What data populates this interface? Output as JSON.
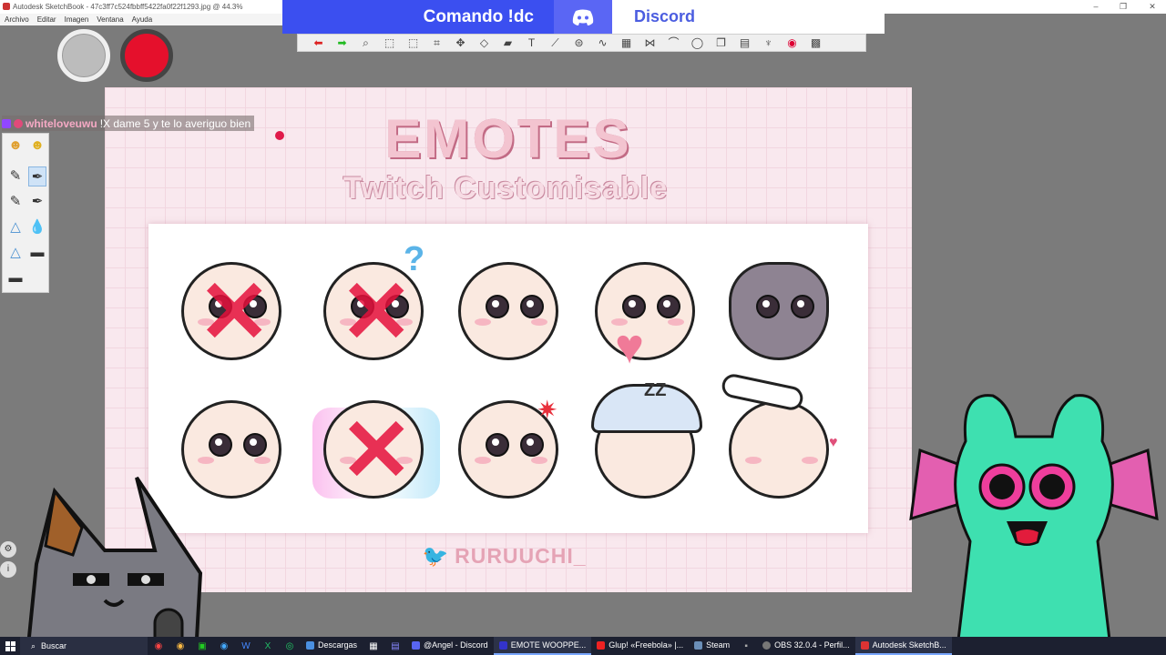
{
  "window": {
    "title": "Autodesk SketchBook - 47c3ff7c524fbbff5422fa0f22f1293.jpg @ 44.3%",
    "controls": [
      "–",
      "❐",
      "✕"
    ]
  },
  "menu": [
    "Archivo",
    "Editar",
    "Imagen",
    "Ventana",
    "Ayuda"
  ],
  "discord_overlay": {
    "command": "Comando !dc",
    "label": "Discord"
  },
  "toolbar": {
    "tools": [
      "undo-icon",
      "redo-icon",
      "zoom-icon",
      "select-icon",
      "lasso-icon",
      "crop-icon",
      "move-icon",
      "distort-icon",
      "fill-icon",
      "text-icon",
      "ruler-icon",
      "ellipse-icon",
      "curve-icon",
      "grid-icon",
      "symmetry-icon",
      "stroke-icon",
      "shape-icon",
      "layers-icon",
      "copic-icon",
      "brushes-icon",
      "color-wheel-icon",
      "palette-icon"
    ]
  },
  "colors": {
    "primary_puck": "#bcbcbc",
    "secondary_puck": "#e5102c",
    "canvas_bg": "#f9e8ee",
    "accent_pink": "#c26b85"
  },
  "canvas": {
    "title": "EMOTES",
    "subtitle": "Twitch Customisable",
    "credit": "RURUUCHI_",
    "emotes": [
      {
        "name": "emote-wave",
        "crossed": true
      },
      {
        "name": "emote-confused",
        "crossed": true
      },
      {
        "name": "emote-sad",
        "crossed": false
      },
      {
        "name": "emote-love",
        "crossed": false
      },
      {
        "name": "emote-shock",
        "crossed": false
      },
      {
        "name": "emote-sparkle",
        "crossed": false
      },
      {
        "name": "emote-hype",
        "crossed": true
      },
      {
        "name": "emote-angry",
        "crossed": false
      },
      {
        "name": "emote-sleep",
        "crossed": false
      },
      {
        "name": "emote-pat",
        "crossed": false
      }
    ]
  },
  "chat": {
    "user": "whiteloveuwu",
    "message": "!X dame 5 y te lo averiguo bien"
  },
  "taskbar": {
    "search": "Buscar",
    "apps": [
      {
        "label": "Descargas",
        "color": "#4a8fe0"
      },
      {
        "label": "@Angel - Discord",
        "color": "#5865f2"
      },
      {
        "label": "EMOTE WOOPPE...",
        "color": "#33c"
      },
      {
        "label": "Glup! «Freebola» |...",
        "color": "#e22"
      },
      {
        "label": "Steam",
        "color": "#1b2838"
      },
      {
        "label": "OBS 32.0.4 - Perfil...",
        "color": "#222"
      },
      {
        "label": "Autodesk SketchB...",
        "color": "#d33"
      }
    ]
  }
}
